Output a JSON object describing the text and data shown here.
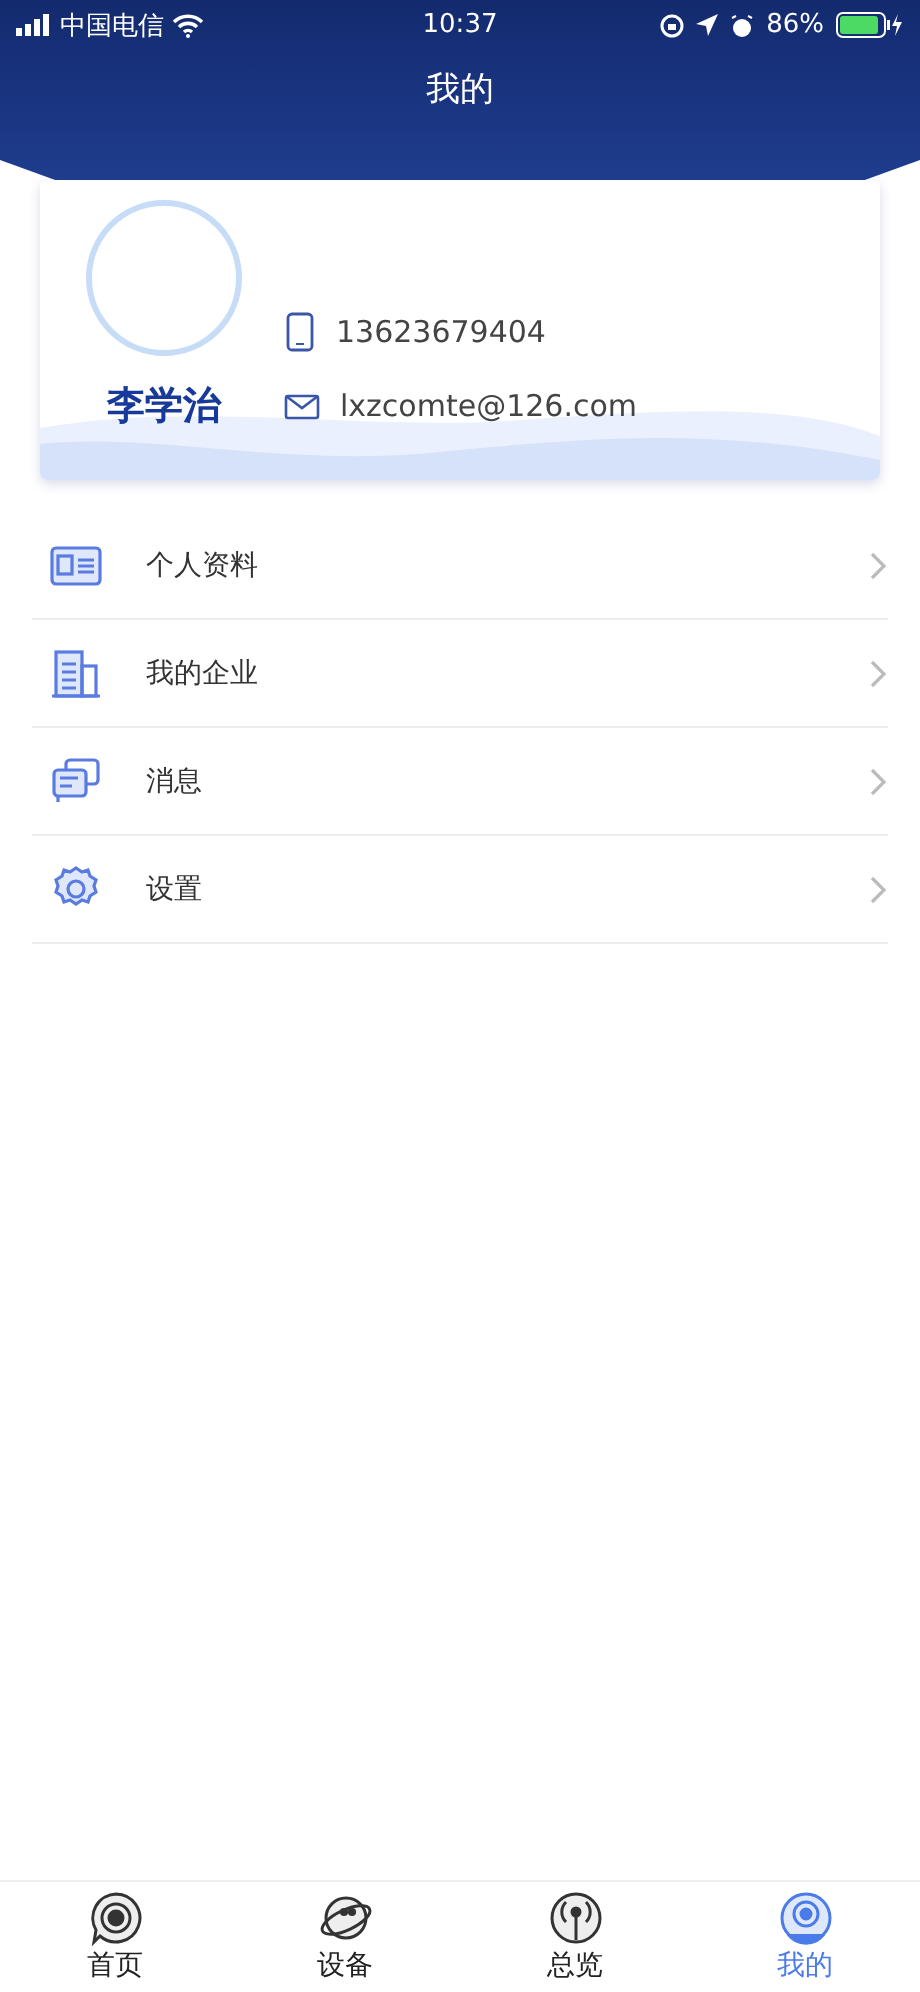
{
  "status_bar": {
    "carrier": "中国电信",
    "time": "10:37",
    "battery": "86%"
  },
  "header": {
    "title": "我的"
  },
  "profile": {
    "name": "李学治",
    "phone": "13623679404",
    "email": "lxzcomte@126.com"
  },
  "menu": [
    {
      "kind": "profile",
      "label": "个人资料"
    },
    {
      "kind": "company",
      "label": "我的企业"
    },
    {
      "kind": "message",
      "label": "消息"
    },
    {
      "kind": "settings",
      "label": "设置"
    }
  ],
  "tab_bar": [
    {
      "kind": "home",
      "label": "首页",
      "selected": false
    },
    {
      "kind": "device",
      "label": "设备",
      "selected": false
    },
    {
      "kind": "overview",
      "label": "总览",
      "selected": false
    },
    {
      "kind": "mine",
      "label": "我的",
      "selected": true
    }
  ]
}
